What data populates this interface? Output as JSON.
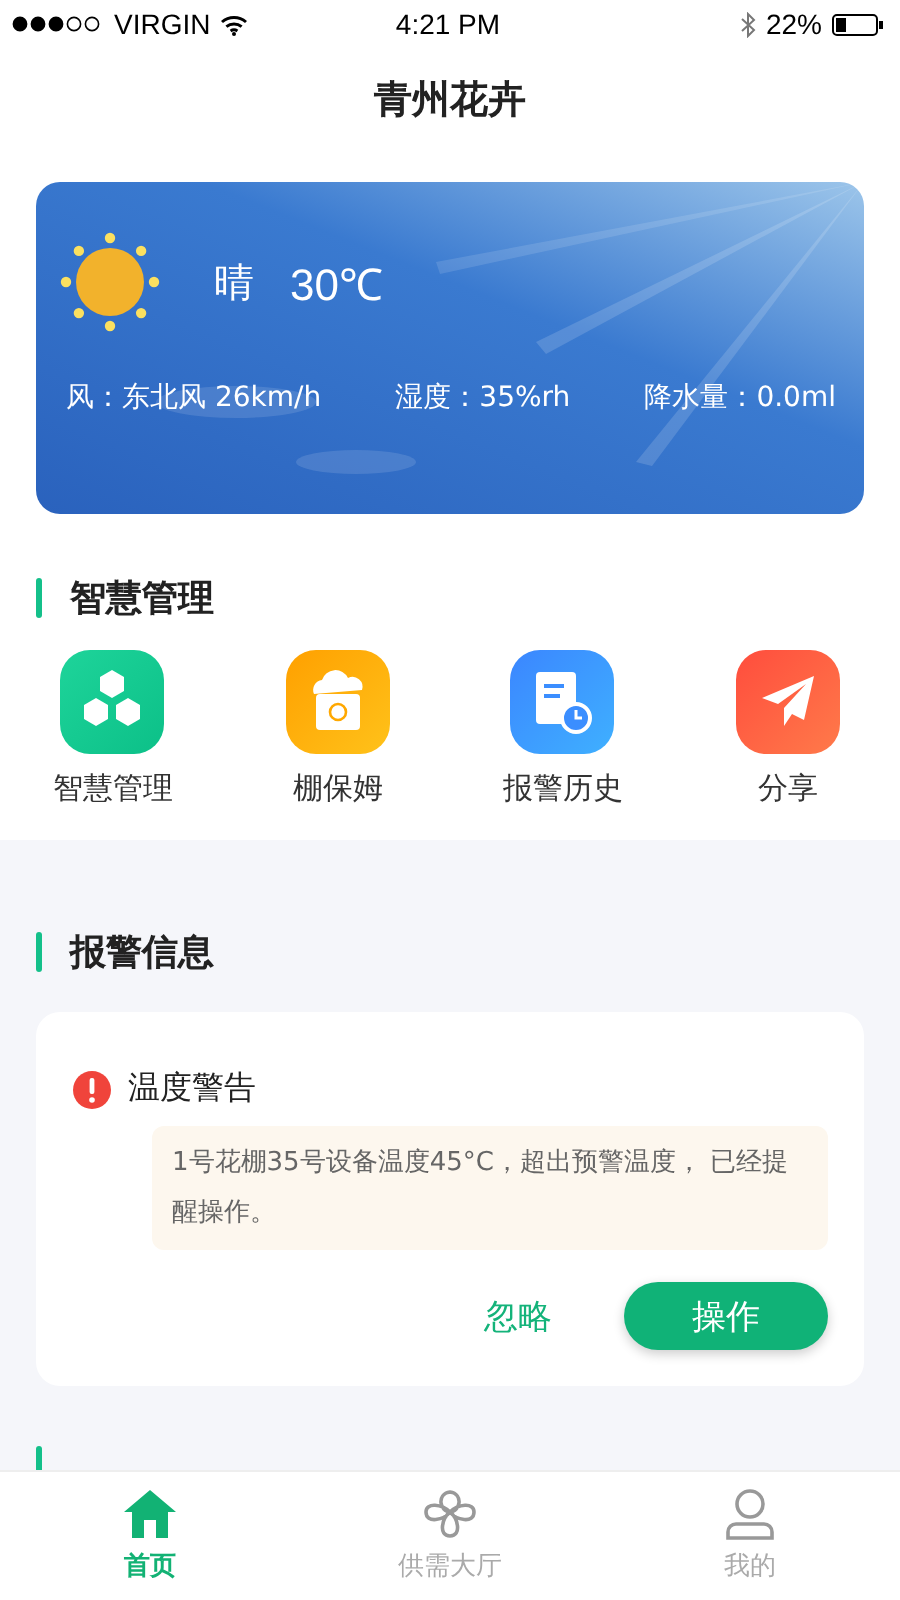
{
  "status_bar": {
    "carrier": "VIRGIN",
    "time": "4:21 PM",
    "battery": "22%"
  },
  "title": "青州花卉",
  "weather": {
    "condition": "晴",
    "temperature": "30℃",
    "details": [
      "风：东北风 26km/h",
      "湿度：35%rh",
      "降水量：0.0ml"
    ]
  },
  "management": {
    "title": "智慧管理",
    "items": [
      {
        "label": "智慧管理",
        "kind": "hexagons"
      },
      {
        "label": "棚保姆",
        "kind": "nanny"
      },
      {
        "label": "报警历史",
        "kind": "history"
      },
      {
        "label": "分享",
        "kind": "share"
      }
    ]
  },
  "alerts": {
    "title": "报警信息",
    "items": [
      {
        "title": "温度警告",
        "message": "1号花棚35号设备温度45°C，超出预警温度， 已经提醒操作。",
        "ignore": "忽略",
        "operate": "操作"
      }
    ]
  },
  "tab_bar": [
    {
      "label": "首页",
      "kind": "home",
      "selected": true
    },
    {
      "label": "供需大厅",
      "kind": "clover",
      "selected": false
    },
    {
      "label": "我的",
      "kind": "person",
      "selected": false
    }
  ]
}
